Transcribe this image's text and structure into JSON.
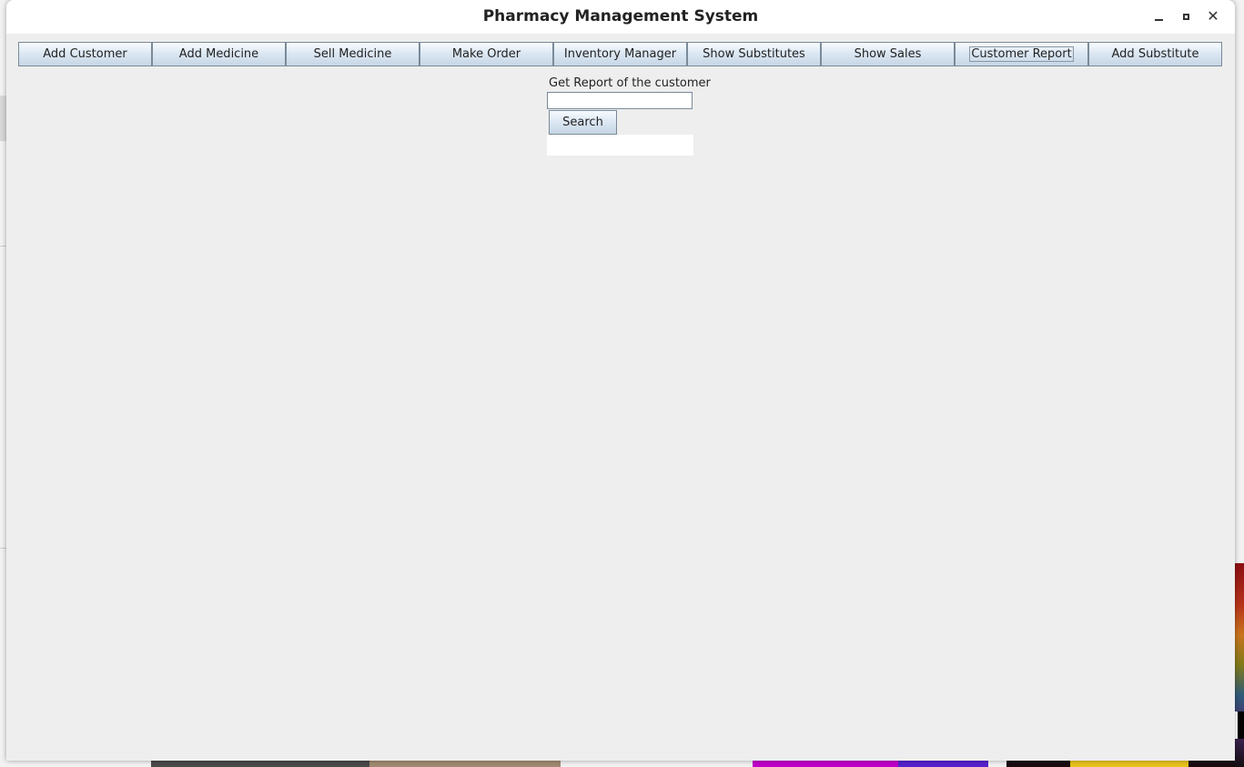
{
  "window": {
    "title": "Pharmacy Management System"
  },
  "toolbar": {
    "buttons": [
      {
        "label": "Add Customer"
      },
      {
        "label": "Add Medicine"
      },
      {
        "label": "Sell Medicine"
      },
      {
        "label": "Make Order"
      },
      {
        "label": "Inventory Manager"
      },
      {
        "label": "Show Substitutes"
      },
      {
        "label": "Show Sales"
      },
      {
        "label": "Customer Report",
        "selected": true
      },
      {
        "label": "Add Substitute"
      }
    ]
  },
  "report": {
    "label": "Get Report of the customer",
    "input_value": "",
    "search_label": "Search",
    "result_text": ""
  },
  "icons": {
    "minimize": "minimize-icon",
    "maximize": "maximize-icon",
    "close": "close-icon"
  },
  "colors": {
    "window_bg": "#eeeeee",
    "titlebar_bg": "#ffffff",
    "button_border": "#7a8a99",
    "button_gradient_top": "#f7fbff",
    "button_gradient_bottom": "#c6d6e6"
  }
}
